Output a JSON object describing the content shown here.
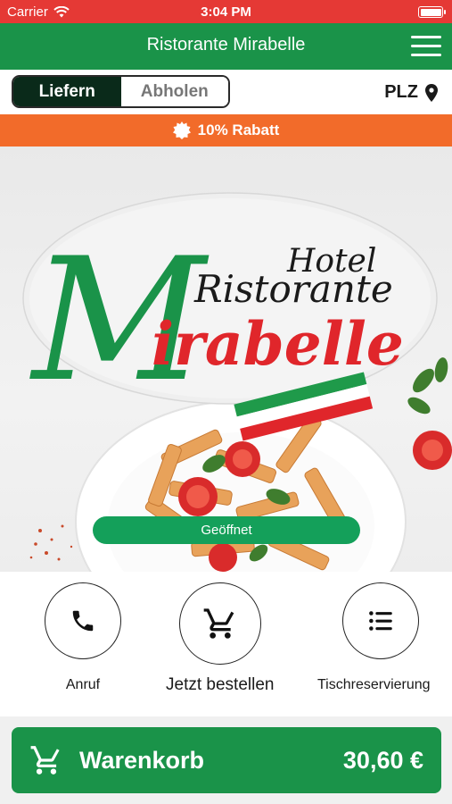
{
  "status_bar": {
    "carrier": "Carrier",
    "time": "3:04 PM"
  },
  "header": {
    "title": "Ristorante Mirabelle"
  },
  "mode_toggle": {
    "deliver": "Liefern",
    "pickup": "Abholen",
    "selected": "Liefern"
  },
  "postcode": {
    "label": "PLZ"
  },
  "promo": {
    "text": "10% Rabatt"
  },
  "hero": {
    "logo_line1": "Hotel",
    "logo_line2": "Ristorante",
    "logo_line3_initial": "M",
    "logo_line3_rest": "irabelle",
    "status": "Geöffnet"
  },
  "actions": [
    {
      "label": "Anruf",
      "icon": "phone-icon"
    },
    {
      "label": "Jetzt bestellen",
      "icon": "cart-icon"
    },
    {
      "label": "Tischreservierung",
      "icon": "list-icon"
    }
  ],
  "cart": {
    "label": "Warenkorb",
    "total": "30,60 €"
  },
  "colors": {
    "status_bar": "#e53935",
    "brand_green": "#1a9349",
    "promo_orange": "#f26b2a",
    "toggle_active": "#0a2a1a",
    "open_green": "#14a05a",
    "logo_red": "#e0262b"
  }
}
